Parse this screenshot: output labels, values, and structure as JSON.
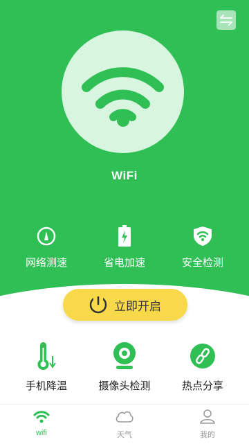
{
  "hero": {
    "title": "WiFi"
  },
  "colors": {
    "brand_green": "#2fbf55",
    "button_yellow": "#f7d94a",
    "inactive_gray": "#9a9a9a"
  },
  "top_features": [
    {
      "label": "网络测速",
      "icon": "speedometer-icon"
    },
    {
      "label": "省电加速",
      "icon": "battery-icon"
    },
    {
      "label": "安全检测",
      "icon": "shield-wifi-icon"
    }
  ],
  "start_button": {
    "label": "立即开启",
    "icon": "power-icon"
  },
  "bottom_features": [
    {
      "label": "手机降温",
      "icon": "thermometer-icon"
    },
    {
      "label": "摄像头检测",
      "icon": "camera-icon"
    },
    {
      "label": "热点分享",
      "icon": "link-icon"
    }
  ],
  "tabs": [
    {
      "label": "wifi",
      "icon": "wifi-icon",
      "active": true
    },
    {
      "label": "天气",
      "icon": "cloud-icon",
      "active": false
    },
    {
      "label": "我的",
      "icon": "person-icon",
      "active": false
    }
  ]
}
